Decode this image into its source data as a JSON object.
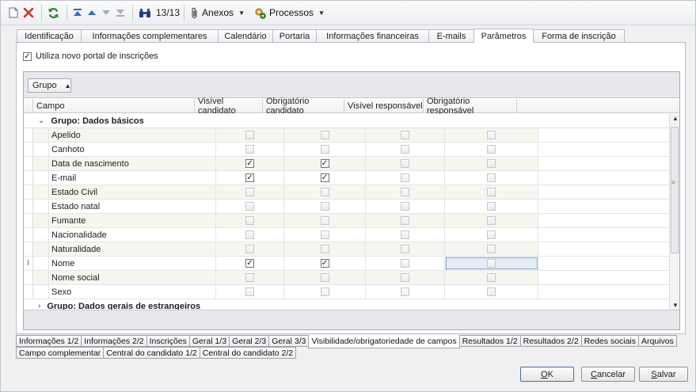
{
  "toolbar": {
    "counter": "13/13",
    "anexos": "Anexos",
    "processos": "Processos",
    "colors": {
      "delete": "#d52a1d",
      "refresh": "#2c8a2c",
      "nav": "#2f6cc0"
    }
  },
  "main_tabs": [
    {
      "label": "Identificação"
    },
    {
      "label": "Informações complementares"
    },
    {
      "label": "Calendário"
    },
    {
      "label": "Portaria"
    },
    {
      "label": "Informações financeiras"
    },
    {
      "label": "E-mails"
    },
    {
      "label": "Parâmetros"
    },
    {
      "label": "Forma de inscrição"
    }
  ],
  "active_main_tab": "Parâmetros",
  "portal_checkbox": {
    "label": "Utiliza novo portal de inscrições",
    "checked": true
  },
  "grid": {
    "group_chip": "Grupo",
    "columns": {
      "campo": "Campo",
      "visivel_candidato": "Visível candidato",
      "obrigatorio_candidato": "Obrigatório candidato",
      "visivel_responsavel": "Visível responsável",
      "obrigatorio_responsavel": "Obrigatório responsável"
    },
    "group1": "Grupo: Dados básicos",
    "group2": "Grupo: Dados gerais de estrangeiros",
    "rows": [
      {
        "name": "Apelido",
        "vc": false,
        "oc": false,
        "vr": false,
        "or": false
      },
      {
        "name": "Canhoto",
        "vc": false,
        "oc": false,
        "vr": false,
        "or": false
      },
      {
        "name": "Data de nascimento",
        "vc": true,
        "oc": true,
        "vr": false,
        "or": false
      },
      {
        "name": "E-mail",
        "vc": true,
        "oc": true,
        "vr": false,
        "or": false
      },
      {
        "name": "Estado Civil",
        "vc": false,
        "oc": false,
        "vr": false,
        "or": false
      },
      {
        "name": "Estado natal",
        "vc": false,
        "oc": false,
        "vr": false,
        "or": false
      },
      {
        "name": "Fumante",
        "vc": false,
        "oc": false,
        "vr": false,
        "or": false
      },
      {
        "name": "Nacionalidade",
        "vc": false,
        "oc": false,
        "vr": false,
        "or": false
      },
      {
        "name": "Naturalidade",
        "vc": false,
        "oc": false,
        "vr": false,
        "or": false
      },
      {
        "name": "Nome",
        "vc": true,
        "oc": true,
        "vr": false,
        "or": false,
        "current": true
      },
      {
        "name": "Nome social",
        "vc": false,
        "oc": false,
        "vr": false,
        "or": false
      },
      {
        "name": "Sexo",
        "vc": false,
        "oc": false,
        "vr": false,
        "or": false
      }
    ]
  },
  "bottom_tabs_row1": [
    {
      "label": "Informações 1/2"
    },
    {
      "label": "Informações 2/2"
    },
    {
      "label": "Inscrições"
    },
    {
      "label": "Geral 1/3"
    },
    {
      "label": "Geral 2/3"
    },
    {
      "label": "Geral 3/3"
    },
    {
      "label": "Visibilidade/obrigatoriedade de campos"
    },
    {
      "label": "Resultados 1/2"
    },
    {
      "label": "Resultados 2/2"
    },
    {
      "label": "Redes sociais"
    },
    {
      "label": "Arquivos"
    }
  ],
  "active_bottom_tab": "Visibilidade/obrigatoriedade de campos",
  "bottom_tabs_row2": [
    {
      "label": "Campo complementar"
    },
    {
      "label": "Central do candidato 1/2"
    },
    {
      "label": "Central do candidato 2/2"
    }
  ],
  "buttons": {
    "ok_u": "O",
    "ok_rest": "K",
    "cancelar_u": "C",
    "cancelar_rest": "ancelar",
    "salvar_u": "S",
    "salvar_rest": "alvar"
  }
}
